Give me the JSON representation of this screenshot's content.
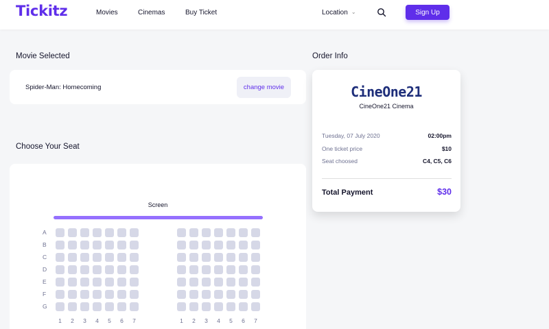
{
  "header": {
    "logo": "Tickitz",
    "nav": [
      "Movies",
      "Cinemas",
      "Buy Ticket"
    ],
    "location_label": "Location",
    "signup_label": "Sign Up"
  },
  "movie_selected": {
    "title": "Movie Selected",
    "movie_name": "Spider-Man: Homecoming",
    "change_label": "change movie"
  },
  "order_info": {
    "title": "Order Info",
    "cinema_logo": "CineOne21",
    "cinema_name": "CineOne21 Cinema",
    "date": "Tuesday, 07 July 2020",
    "time": "02:00pm",
    "price_label": "One ticket price",
    "price": "$10",
    "seat_label": "Seat choosed",
    "seats": "C4, C5, C6",
    "total_label": "Total Payment",
    "total": "$30"
  },
  "seating": {
    "title": "Choose Your Seat",
    "screen_label": "Screen",
    "rows": [
      "A",
      "B",
      "C",
      "D",
      "E",
      "F",
      "G"
    ],
    "left_columns": [
      "1",
      "2",
      "3",
      "4",
      "5",
      "6",
      "7"
    ],
    "right_columns": [
      "1",
      "2",
      "3",
      "4",
      "5",
      "6",
      "7"
    ]
  },
  "colors": {
    "accent": "#5f2eea",
    "seat_available": "#d6d8e7",
    "screen": "#9570fe"
  }
}
